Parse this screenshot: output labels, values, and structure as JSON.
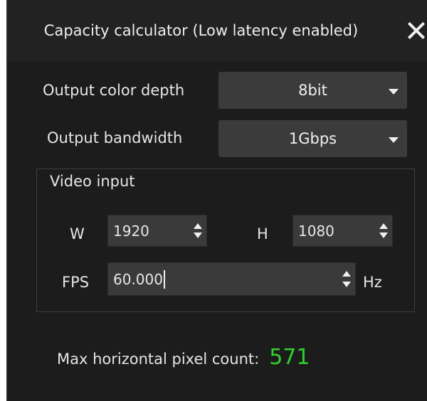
{
  "window": {
    "title": "Capacity calculator (Low latency enabled)"
  },
  "output_color_depth": {
    "label": "Output color depth",
    "value": "8bit"
  },
  "output_bandwidth": {
    "label": "Output bandwidth",
    "value": "1Gbps"
  },
  "video_input": {
    "group_label": "Video input",
    "width_label": "W",
    "width_value": "1920",
    "height_label": "H",
    "height_value": "1080",
    "fps_label": "FPS",
    "fps_value": "60.000",
    "fps_unit": "Hz"
  },
  "result": {
    "label": "Max horizontal pixel count:",
    "value": "571",
    "value_color": "#2fd12f"
  },
  "icons": {
    "close": "close-icon",
    "dropdown": "chevron-down-icon",
    "spin_up": "spin-up-icon",
    "spin_down": "spin-down-icon"
  }
}
